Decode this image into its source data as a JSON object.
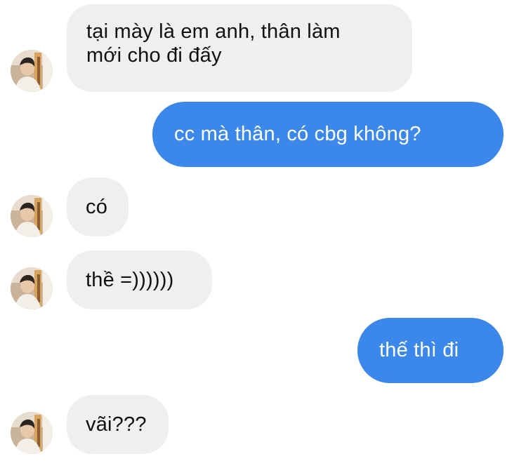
{
  "conversation": {
    "messages": [
      {
        "sender": "them",
        "text_lines": [
          "tại mày là em anh, thân làm",
          "mới cho đi đấy"
        ],
        "has_avatar": true
      },
      {
        "sender": "me",
        "text": "cc mà thân, có cbg không?"
      },
      {
        "sender": "them",
        "text": "có",
        "has_avatar": true
      },
      {
        "sender": "them",
        "text": "thề =))))))",
        "has_avatar": true
      },
      {
        "sender": "me",
        "text": "thế thì đi"
      },
      {
        "sender": "them",
        "text": "vãi???",
        "has_avatar": true
      }
    ],
    "colors": {
      "incoming_bubble": "#efefef",
      "outgoing_bubble": "#3b87ea",
      "incoming_text": "#111111",
      "outgoing_text": "#ffffff"
    }
  }
}
